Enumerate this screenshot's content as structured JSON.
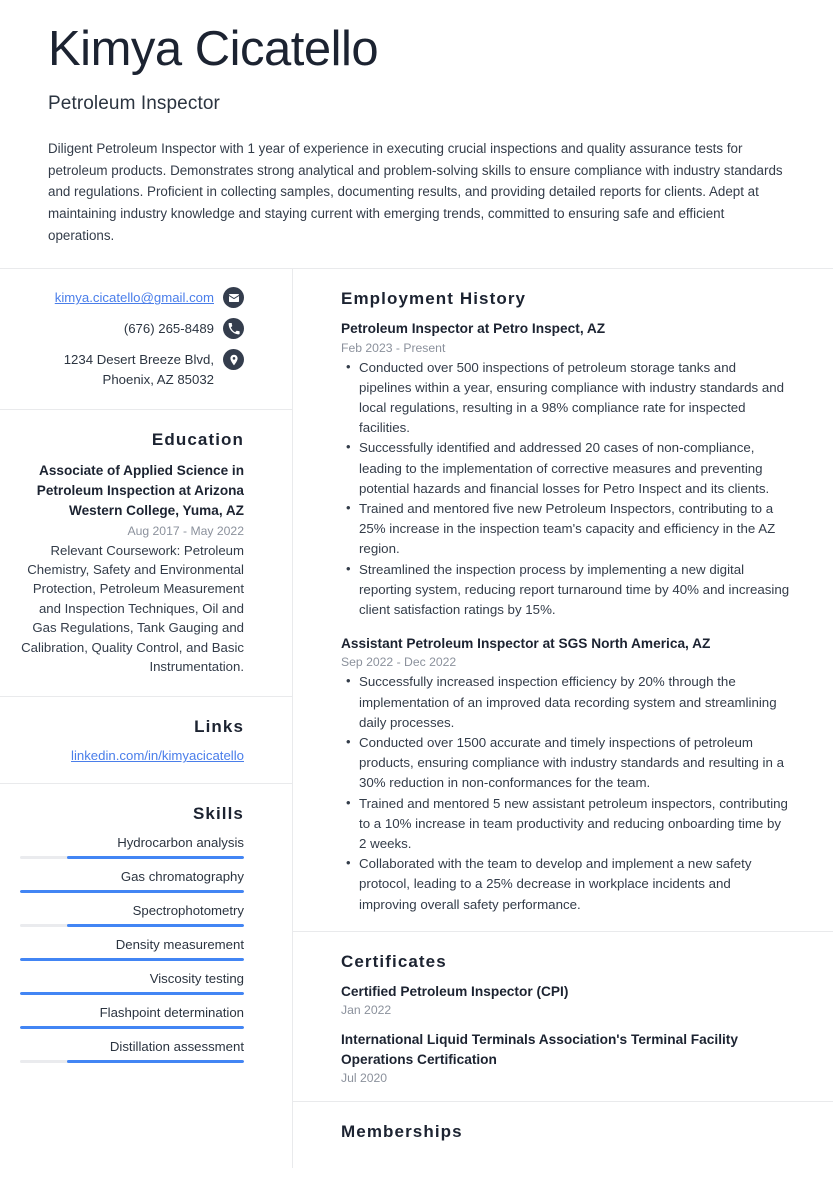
{
  "header": {
    "name": "Kimya Cicatello",
    "job_title": "Petroleum Inspector",
    "summary": "Diligent Petroleum Inspector with 1 year of experience in executing crucial inspections and quality assurance tests for petroleum products. Demonstrates strong analytical and problem-solving skills to ensure compliance with industry standards and regulations. Proficient in collecting samples, documenting results, and providing detailed reports for clients. Adept at maintaining industry knowledge and staying current with emerging trends, committed to ensuring safe and efficient operations."
  },
  "contact": {
    "email": "kimya.cicatello@gmail.com",
    "phone": "(676) 265-8489",
    "address_line1": "1234 Desert Breeze Blvd,",
    "address_line2": "Phoenix, AZ 85032",
    "icons": {
      "email": "envelope-icon",
      "phone": "phone-icon",
      "address": "map-pin-icon"
    }
  },
  "education": {
    "heading": "Education",
    "entries": [
      {
        "title": "Associate of Applied Science in Petroleum Inspection at Arizona Western College, Yuma, AZ",
        "date": "Aug 2017 - May 2022",
        "description": "Relevant Coursework: Petroleum Chemistry, Safety and Environmental Protection, Petroleum Measurement and Inspection Techniques, Oil and Gas Regulations, Tank Gauging and Calibration, Quality Control, and Basic Instrumentation."
      }
    ]
  },
  "links": {
    "heading": "Links",
    "items": [
      {
        "label": "linkedin.com/in/kimyacicatello"
      }
    ]
  },
  "skills": {
    "heading": "Skills",
    "items": [
      {
        "label": "Hydrocarbon analysis",
        "level": 79
      },
      {
        "label": "Gas chromatography",
        "level": 100
      },
      {
        "label": "Spectrophotometry",
        "level": 79
      },
      {
        "label": "Density measurement",
        "level": 100
      },
      {
        "label": "Viscosity testing",
        "level": 100
      },
      {
        "label": "Flashpoint determination",
        "level": 100
      },
      {
        "label": "Distillation assessment",
        "level": 79
      }
    ]
  },
  "employment": {
    "heading": "Employment History",
    "jobs": [
      {
        "title": "Petroleum Inspector at Petro Inspect, AZ",
        "date": "Feb 2023 - Present",
        "bullets": [
          "Conducted over 500 inspections of petroleum storage tanks and pipelines within a year, ensuring compliance with industry standards and local regulations, resulting in a 98% compliance rate for inspected facilities.",
          "Successfully identified and addressed 20 cases of non-compliance, leading to the implementation of corrective measures and preventing potential hazards and financial losses for Petro Inspect and its clients.",
          "Trained and mentored five new Petroleum Inspectors, contributing to a 25% increase in the inspection team's capacity and efficiency in the AZ region.",
          "Streamlined the inspection process by implementing a new digital reporting system, reducing report turnaround time by 40% and increasing client satisfaction ratings by 15%."
        ]
      },
      {
        "title": "Assistant Petroleum Inspector at SGS North America, AZ",
        "date": "Sep 2022 - Dec 2022",
        "bullets": [
          "Successfully increased inspection efficiency by 20% through the implementation of an improved data recording system and streamlining daily processes.",
          "Conducted over 1500 accurate and timely inspections of petroleum products, ensuring compliance with industry standards and resulting in a 30% reduction in non-conformances for the team.",
          "Trained and mentored 5 new assistant petroleum inspectors, contributing to a 10% increase in team productivity and reducing onboarding time by 2 weeks.",
          "Collaborated with the team to develop and implement a new safety protocol, leading to a 25% decrease in workplace incidents and improving overall safety performance."
        ]
      }
    ]
  },
  "certificates": {
    "heading": "Certificates",
    "items": [
      {
        "title": "Certified Petroleum Inspector (CPI)",
        "date": "Jan 2022"
      },
      {
        "title": "International Liquid Terminals Association's Terminal Facility Operations Certification",
        "date": "Jul 2020"
      }
    ]
  },
  "memberships": {
    "heading": "Memberships"
  },
  "colors": {
    "heading": "#1c2331",
    "body_text": "#333c49",
    "muted": "#8b919c",
    "link": "#4a7eea",
    "accent_bar": "#4285f4",
    "track": "#eaebee",
    "icon_bg": "#343d4d",
    "divider": "#e9eaec"
  }
}
